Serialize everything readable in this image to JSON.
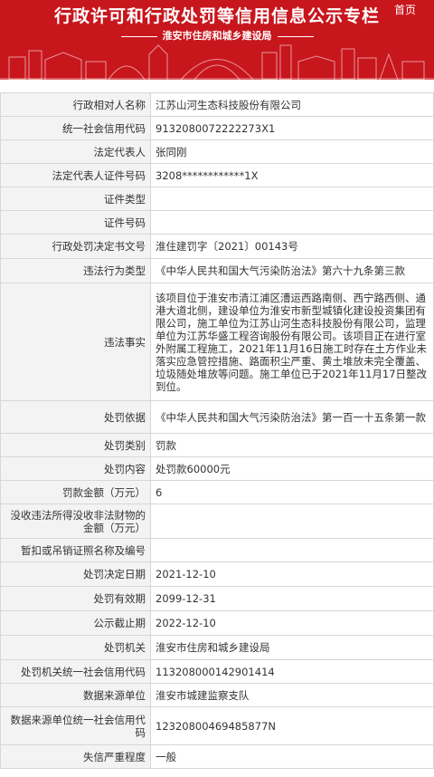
{
  "header": {
    "title": "行政许可和行政处罚等信用信息公示专栏",
    "home_link": "首页",
    "subtitle": "淮安市住房和城乡建设局"
  },
  "colors": {
    "banner_red": "#c8161d",
    "label_bg": "#f3f3f3",
    "border": "#d7d7d7"
  },
  "record": {
    "rows": [
      {
        "label": "行政相对人名称",
        "value": "江苏山河生态科技股份有限公司"
      },
      {
        "label": "统一社会信用代码",
        "value": "9132080072222273X1"
      },
      {
        "label": "法定代表人",
        "value": "张同刚"
      },
      {
        "label": "法定代表人证件号码",
        "value": "3208************1X"
      },
      {
        "label": "证件类型",
        "value": ""
      },
      {
        "label": "证件号码",
        "value": ""
      },
      {
        "label": "行政处罚决定书文号",
        "value": "淮住建罚字〔2021〕00143号"
      },
      {
        "label": "违法行为类型",
        "value": "《中华人民共和国大气污染防治法》第六十九条第三款"
      },
      {
        "label": "违法事实",
        "value": "该项目位于淮安市清江浦区漕运西路南侧、西宁路西侧、通港大道北侧，建设单位为淮安市新型城镇化建设投资集团有限公司，施工单位为江苏山河生态科技股份有限公司，监理单位为江苏华盛工程咨询股份有限公司。该项目正在进行室外附属工程施工，2021年11月16日施工时存在土方作业未落实应急管控措施、路面积尘严重、黄土堆放未完全覆盖、垃圾随处堆放等问题。施工单位已于2021年11月17日整改到位。"
      },
      {
        "label": "处罚依据",
        "value": "《中华人民共和国大气污染防治法》第一百一十五条第一款"
      },
      {
        "label": "处罚类别",
        "value": "罚款"
      },
      {
        "label": "处罚内容",
        "value": "处罚款60000元"
      },
      {
        "label": "罚款金额（万元）",
        "value": "6"
      },
      {
        "label": "没收违法所得没收非法财物的金额（万元）",
        "value": ""
      },
      {
        "label": "暂扣或吊销证照名称及编号",
        "value": ""
      },
      {
        "label": "处罚决定日期",
        "value": "2021-12-10"
      },
      {
        "label": "处罚有效期",
        "value": "2099-12-31"
      },
      {
        "label": "公示截止期",
        "value": "2022-12-10"
      },
      {
        "label": "处罚机关",
        "value": "淮安市住房和城乡建设局"
      },
      {
        "label": "处罚机关统一社会信用代码",
        "value": "113208000142901414"
      },
      {
        "label": "数据来源单位",
        "value": "淮安市城建监察支队"
      },
      {
        "label": "数据来源单位统一社会信用代码",
        "value": "12320800469485877N"
      },
      {
        "label": "失信严重程度",
        "value": "一般"
      }
    ]
  }
}
